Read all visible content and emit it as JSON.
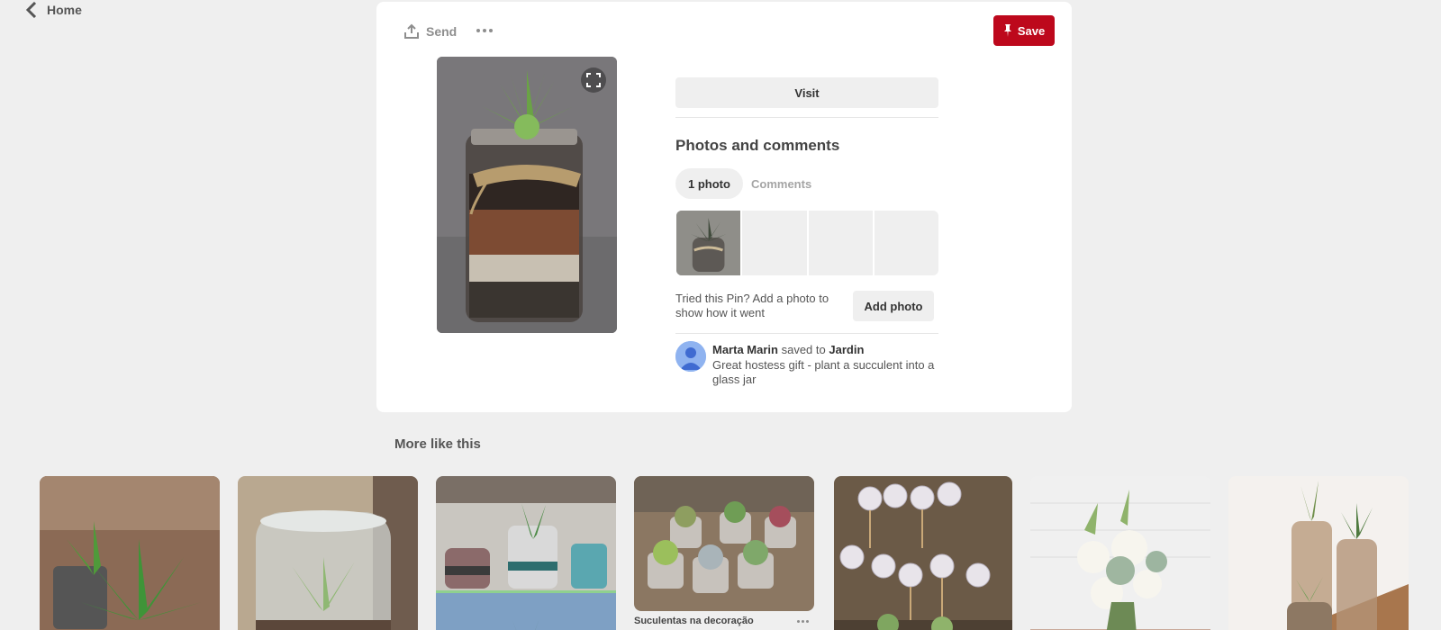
{
  "nav": {
    "home_label": "Home"
  },
  "toolbar": {
    "send_label": "Send",
    "save_label": "Save"
  },
  "pin": {
    "visit_label": "Visit",
    "section_title": "Photos and comments",
    "tabs": [
      {
        "label": "1 photo"
      },
      {
        "label": "Comments"
      }
    ],
    "tried_text": "Tried this Pin? Add a photo to show how it went",
    "add_photo_label": "Add photo",
    "saver": {
      "name": "Marta Marin",
      "action": "saved to",
      "board": "Jardin",
      "description": "Great hostess gift - plant a succulent into a glass jar"
    }
  },
  "more": {
    "title": "More like this",
    "items": [
      {
        "caption": ""
      },
      {
        "caption": ""
      },
      {
        "caption": ""
      },
      {
        "caption": "Suculentas na decoração"
      },
      {
        "caption": ""
      },
      {
        "caption": ""
      },
      {
        "caption": ""
      }
    ]
  },
  "colors": {
    "save_red": "#bd081c",
    "background": "#efefef"
  }
}
